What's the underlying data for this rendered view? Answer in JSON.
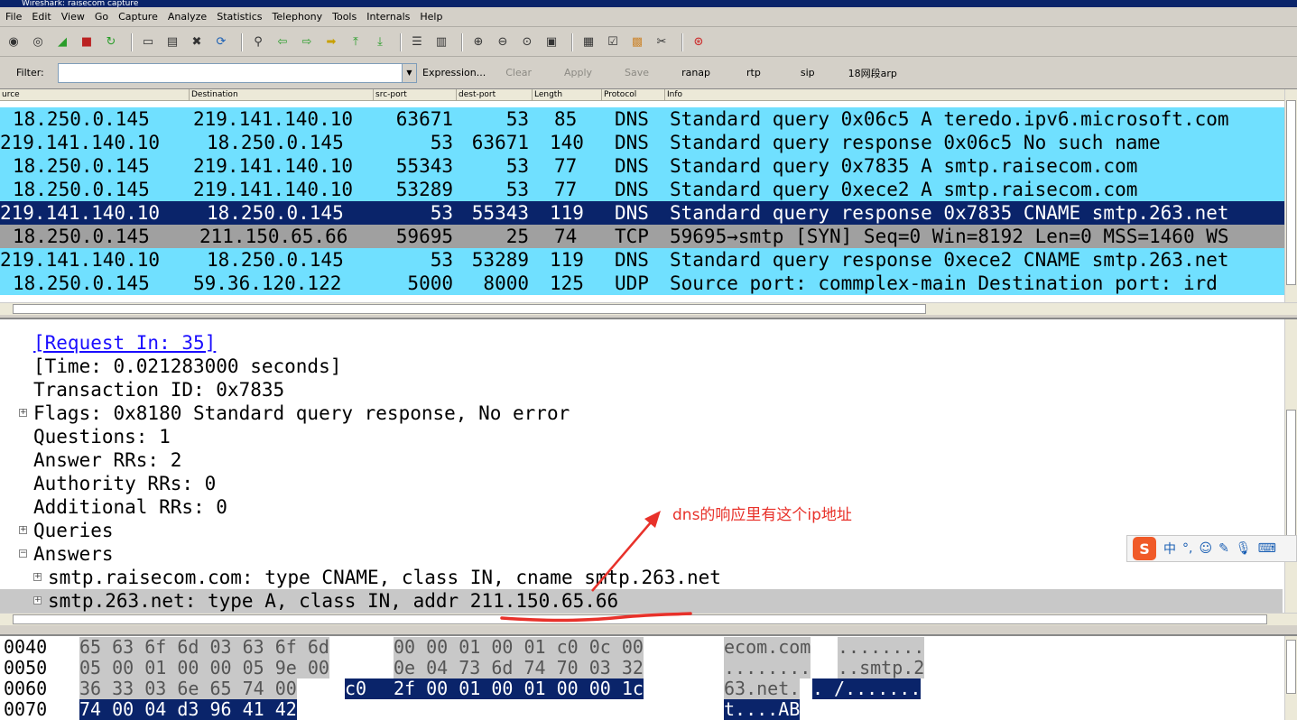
{
  "title": "Wireshark: raisecom capture",
  "menu": [
    "File",
    "Edit",
    "View",
    "Go",
    "Capture",
    "Analyze",
    "Statistics",
    "Telephony",
    "Tools",
    "Internals",
    "Help"
  ],
  "toolbar_icons": [
    "interface-list-icon",
    "capture-options-icon",
    "start-capture-icon",
    "stop-capture-icon",
    "restart-capture-icon",
    "open-file-icon",
    "save-file-icon",
    "close-file-icon",
    "reload-icon",
    "find-packet-icon",
    "go-back-icon",
    "go-forward-icon",
    "go-to-packet-icon",
    "go-first-icon",
    "go-last-icon",
    "colorize-icon",
    "autoscroll-icon",
    "zoom-in-icon",
    "zoom-out-icon",
    "normal-size-icon",
    "resize-columns-icon",
    "capture-filters-icon",
    "display-filters-icon",
    "coloring-rules-icon",
    "preferences-icon",
    "help-icon"
  ],
  "filter": {
    "label": "Filter:",
    "value": "",
    "buttons": [
      "Expression...",
      "Clear",
      "Apply",
      "Save",
      "ranap",
      "rtp",
      "sip",
      "18网段arp"
    ],
    "disabled": [
      false,
      true,
      true,
      true,
      false,
      false,
      false,
      false
    ]
  },
  "columns": [
    "urce",
    "Destination",
    "src-port",
    "dest-port",
    "Length",
    "Protocol",
    "Info"
  ],
  "packets": [
    {
      "src": "18.250.0.145",
      "dst": "219.141.140.10",
      "sport": "63671",
      "dport": "53",
      "len": "85",
      "proto": "DNS",
      "info": "Standard query 0x06c5  A teredo.ipv6.microsoft.com"
    },
    {
      "src": "219.141.140.10",
      "dst": "18.250.0.145",
      "sport": "53",
      "dport": "63671",
      "len": "140",
      "proto": "DNS",
      "info": "Standard query response 0x06c5 No such name"
    },
    {
      "src": "18.250.0.145",
      "dst": "219.141.140.10",
      "sport": "55343",
      "dport": "53",
      "len": "77",
      "proto": "DNS",
      "info": "Standard query 0x7835  A smtp.raisecom.com"
    },
    {
      "src": "18.250.0.145",
      "dst": "219.141.140.10",
      "sport": "53289",
      "dport": "53",
      "len": "77",
      "proto": "DNS",
      "info": "Standard query 0xece2  A smtp.raisecom.com"
    },
    {
      "src": "219.141.140.10",
      "dst": "18.250.0.145",
      "sport": "53",
      "dport": "55343",
      "len": "119",
      "proto": "DNS",
      "info": "Standard query response 0x7835  CNAME smtp.263.net"
    },
    {
      "src": "18.250.0.145",
      "dst": "211.150.65.66",
      "sport": "59695",
      "dport": "25",
      "len": "74",
      "proto": "TCP",
      "info": "59695→smtp [SYN] Seq=0 Win=8192 Len=0 MSS=1460 WS"
    },
    {
      "src": "219.141.140.10",
      "dst": "18.250.0.145",
      "sport": "53",
      "dport": "53289",
      "len": "119",
      "proto": "DNS",
      "info": "Standard query response 0xece2  CNAME smtp.263.net"
    },
    {
      "src": "18.250.0.145",
      "dst": "59.36.120.122",
      "sport": "5000",
      "dport": "8000",
      "len": "125",
      "proto": "UDP",
      "info": "Source port: commplex-main  Destination port: ird"
    }
  ],
  "details": [
    {
      "text": "[Request In: 35]",
      "link": true
    },
    {
      "text": "[Time: 0.021283000 seconds]"
    },
    {
      "text": "Transaction ID: 0x7835"
    },
    {
      "text": "Flags: 0x8180 Standard query response, No error",
      "expand": "+"
    },
    {
      "text": "Questions: 1"
    },
    {
      "text": "Answer RRs: 2"
    },
    {
      "text": "Authority RRs: 0"
    },
    {
      "text": "Additional RRs: 0"
    },
    {
      "text": "Queries",
      "expand": "+"
    },
    {
      "text": "Answers",
      "expand": "−"
    },
    {
      "text": "smtp.raisecom.com: type CNAME, class IN, cname smtp.263.net",
      "expand": "+",
      "indent": 1
    },
    {
      "text": "smtp.263.net: type A, class IN, addr 211.150.65.66",
      "expand": "+",
      "indent": 1,
      "highlight": true
    }
  ],
  "hex": [
    {
      "offset": "0040",
      "bytes_a": "65 63 6f 6d 03 63 6f 6d",
      "bytes_b": "00 00 01 00 01 c0 0c 00",
      "ascii_a": "ecom.com",
      "ascii_b": "........"
    },
    {
      "offset": "0050",
      "bytes_a": "05 00 01 00 00 05 9e 00",
      "bytes_b": "0e 04 73 6d 74 70 03 32",
      "ascii_a": "........",
      "ascii_b": "..smtp.2"
    },
    {
      "offset": "0060",
      "bytes_a": "36 33 03 6e 65 74 00",
      "bytes_sel_a": "c0",
      "bytes_b": "2f 00 01 00 01 00 00 1c",
      "ascii_a": "63.net.",
      "ascii_sel_a": ".",
      "ascii_b": " /......."
    },
    {
      "offset": "0070",
      "bytes_sel": "74 00 04 d3 96 41 42",
      "ascii_sel": "t....AB"
    }
  ],
  "annotation": "dns的响应里有这个ip地址",
  "ime": {
    "lang": "中",
    "punct": "°,",
    "icons": [
      "emoji-icon",
      "pen-icon",
      "mic-icon",
      "keyboard-icon"
    ]
  },
  "colors": {
    "dns": "#70e0ff",
    "selected": "#0a246a",
    "tcp": "#a0a0a0",
    "annotation": "#e8312a"
  }
}
